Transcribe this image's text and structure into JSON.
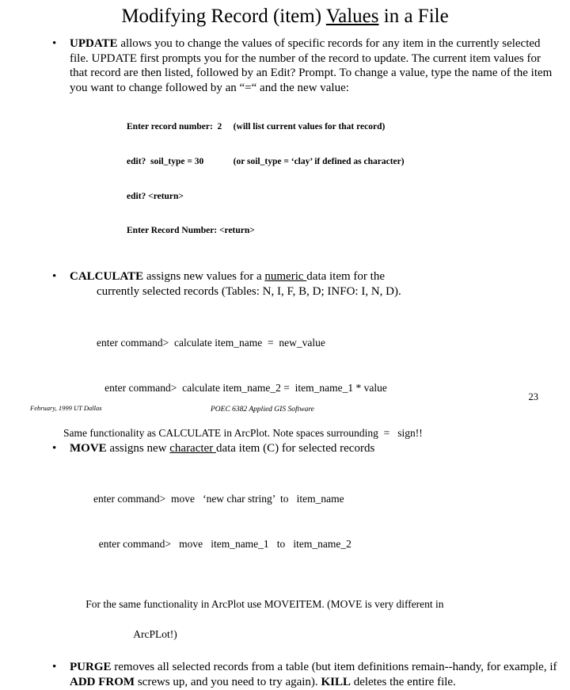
{
  "slide": {
    "title_parts": {
      "before": "Modifying Record (item) ",
      "underlined": "Values",
      "after": " in a File"
    },
    "bullet_char": "•"
  },
  "bullets": {
    "update": {
      "keyword": "UPDATE",
      "body": " allows you to change the values of specific records for any item in the currently selected file.  UPDATE first prompts you for the number of the record to update.  The current item values for that record are then listed, followed by an Edit? Prompt.  To change a value, type the name of the item you want to change followed by an “=“ and the new value:"
    },
    "calculate": {
      "keyword": "CALCULATE",
      "body_before": " assigns new values for a ",
      "underlined": "numeric ",
      "body_after": "data item for the",
      "line2": "currently selected records  (Tables: N, I, F, B, D;  INFO: I, N, D)."
    },
    "move": {
      "keyword": "MOVE",
      "body_before": "  assigns new ",
      "underlined": "character ",
      "body_after": "data item (C) for selected records"
    },
    "purge": {
      "keyword": "PURGE",
      "body_before": "   removes all selected records from a table (but item definitions remain--handy, for example,  if  ",
      "bold_mid": "ADD FROM",
      "body_mid": " screws up, and you need to try again). ",
      "bold_end": "KILL",
      "body_after": " deletes the entire file."
    }
  },
  "update_example": {
    "lines": [
      "Enter record number:  2     (will list current values for that record)",
      "edit?  soil_type = 30             (or soil_type = ‘clay’ if defined as character)",
      "edit? <return>",
      "Enter Record Number: <return>"
    ]
  },
  "calculate_commands": {
    "lines": [
      "enter command>  calculate item_name  =  new_value",
      "   enter command>  calculate item_name_2 =  item_name_1 * value"
    ],
    "note": "Same functionality as CALCULATE in ArcPlot. Note spaces surrounding  =   sign!!"
  },
  "move_commands": {
    "lines": [
      "enter command>  move   ‘new char string’  to   item_name",
      "  enter command>   move   item_name_1   to   item_name_2"
    ],
    "note": "For the same functionality in ArcPlot use MOVEITEM. (MOVE is very different in",
    "note_line2": "ArcPLot!)"
  },
  "footer": {
    "left": "February, 1999  UT Dallas",
    "center": "POEC 6382 Applied GIS Software",
    "page_number": "23"
  }
}
